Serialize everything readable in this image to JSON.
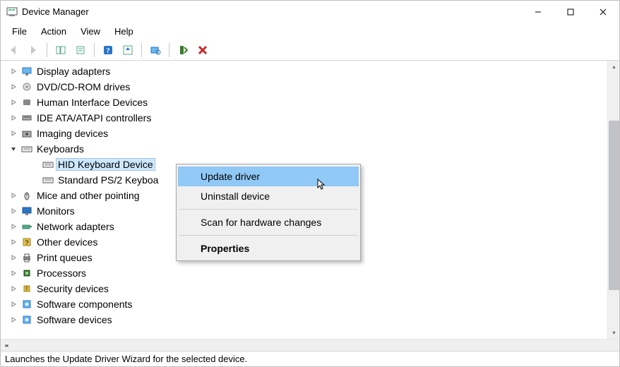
{
  "window_title": "Device Manager",
  "menu": {
    "file": "File",
    "action": "Action",
    "view": "View",
    "help": "Help"
  },
  "tree": {
    "items": [
      {
        "label": "Display adapters",
        "icon": "monitor"
      },
      {
        "label": "DVD/CD-ROM drives",
        "icon": "disc"
      },
      {
        "label": "Human Interface Devices",
        "icon": "hid"
      },
      {
        "label": "IDE ATA/ATAPI controllers",
        "icon": "ide"
      },
      {
        "label": "Imaging devices",
        "icon": "camera"
      },
      {
        "label": "Keyboards",
        "icon": "keyboard",
        "expanded": true,
        "children": [
          {
            "label": "HID Keyboard Device",
            "selected": true
          },
          {
            "label": "Standard PS/2 Keyboa"
          }
        ]
      },
      {
        "label": "Mice and other pointing",
        "icon": "mouse"
      },
      {
        "label": "Monitors",
        "icon": "monitor2"
      },
      {
        "label": "Network adapters",
        "icon": "network"
      },
      {
        "label": "Other devices",
        "icon": "other"
      },
      {
        "label": "Print queues",
        "icon": "printer"
      },
      {
        "label": "Processors",
        "icon": "cpu"
      },
      {
        "label": "Security devices",
        "icon": "security"
      },
      {
        "label": "Software components",
        "icon": "software"
      },
      {
        "label": "Software devices",
        "icon": "software"
      }
    ]
  },
  "context_menu": {
    "update": "Update driver",
    "uninstall": "Uninstall device",
    "scan": "Scan for hardware changes",
    "properties": "Properties"
  },
  "status_text": "Launches the Update Driver Wizard for the selected device."
}
